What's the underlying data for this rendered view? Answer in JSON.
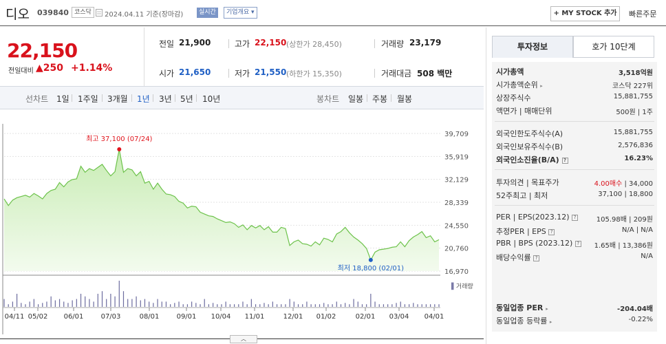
{
  "header": {
    "name": "디오",
    "code": "039840",
    "market": "코스닥",
    "date": "2024.04.11 기준(장마감)",
    "realtime": "실시간",
    "company": "기업개요 ▾",
    "mystock": "+ MY STOCK 추가",
    "quick_order": "빠른주문"
  },
  "summary": {
    "price": "22,150",
    "change_label": "전일대비",
    "change_value": "▲250",
    "change_pct": "+1.14%",
    "prev_label": "전일",
    "prev": "21,900",
    "high_label": "고가",
    "high": "22,150",
    "upper_limit": "(상한가 28,450)",
    "volume_label": "거래량",
    "volume": "23,179",
    "open_label": "시가",
    "open": "21,650",
    "low_label": "저가",
    "low": "21,550",
    "lower_limit": "(하한가 15,350)",
    "amount_label": "거래대금",
    "amount": "508 백만"
  },
  "periods": {
    "line_label": "선차트",
    "items": [
      "1일",
      "1주일",
      "3개월",
      "1년",
      "3년",
      "5년",
      "10년"
    ],
    "active": "1년",
    "candle_label": "봉차트",
    "candle_items": [
      "일봉",
      "주봉",
      "월봉"
    ]
  },
  "chart_data": {
    "type": "area",
    "y_ticks": [
      "39,709",
      "35,919",
      "32,129",
      "28,339",
      "24,550",
      "20,760",
      "16,970"
    ],
    "ylim": [
      16970,
      39709
    ],
    "x_ticks": [
      "04/11",
      "05/02",
      "06/01",
      "07/03",
      "08/01",
      "09/01",
      "10/04",
      "11/01",
      "12/01",
      "01/02",
      "02/01",
      "03/04",
      "04/01"
    ],
    "series": [
      {
        "values": [
          28900,
          27800,
          28700,
          29100,
          29300,
          29500,
          29200,
          29800,
          29400,
          28900,
          29800,
          30300,
          30500,
          31600,
          30900,
          31700,
          32100,
          32200,
          34300,
          33300,
          33900,
          33600,
          34100,
          34600,
          33600,
          32700,
          33400,
          37100,
          33300,
          33900,
          33700,
          32700,
          33400,
          31500,
          31800,
          30500,
          31500,
          30500,
          29700,
          29600,
          29300,
          28500,
          28200,
          27400,
          27700,
          27600,
          26700,
          26400,
          26100,
          26000,
          25600,
          25300,
          25000,
          25100,
          24800,
          24200,
          24600,
          23800,
          24500,
          24100,
          24500,
          23800,
          24300,
          23400,
          23400,
          24200,
          24000,
          21200,
          21800,
          22100,
          21500,
          21400,
          21100,
          21800,
          21300,
          22400,
          22200,
          21800,
          23100,
          23500,
          24200,
          23300,
          22600,
          22100,
          21500,
          20700,
          18800,
          20100,
          20500,
          20600,
          20700,
          20900,
          21000,
          21800,
          21000,
          22000,
          22600,
          23000,
          23500,
          22500,
          22800,
          21800,
          22150
        ]
      }
    ],
    "volume": [
      0.3,
      0.1,
      0.2,
      0.5,
      0.15,
      0.1,
      0.2,
      0.3,
      0.1,
      0.15,
      0.2,
      0.4,
      0.25,
      0.3,
      0.2,
      0.15,
      0.25,
      0.3,
      0.5,
      0.4,
      0.3,
      0.2,
      0.5,
      0.6,
      0.3,
      0.5,
      0.4,
      1.0,
      0.6,
      0.3,
      0.3,
      0.4,
      0.25,
      0.3,
      0.2,
      0.15,
      0.3,
      0.2,
      0.2,
      0.1,
      0.15,
      0.2,
      0.1,
      0.1,
      0.2,
      0.15,
      0.1,
      0.3,
      0.1,
      0.15,
      0.1,
      0.1,
      0.2,
      0.1,
      0.1,
      0.1,
      0.2,
      0.1,
      0.3,
      0.1,
      0.1,
      0.15,
      0.1,
      0.2,
      0.1,
      0.1,
      0.1,
      0.3,
      0.2,
      0.1,
      0.1,
      0.2,
      0.1,
      0.1,
      0.1,
      0.15,
      0.1,
      0.1,
      0.2,
      0.1,
      0.15,
      0.1,
      0.3,
      0.2,
      0.1,
      0.1,
      0.5,
      0.2,
      0.1,
      0.1,
      0.1,
      0.1,
      0.15,
      0.2,
      0.1,
      0.1,
      0.15,
      0.1,
      0.1,
      0.1,
      0.1,
      0.1,
      0.1
    ],
    "high_label": "최고 37,100 (07/24)",
    "low_label": "최저 18,800 (02/01)",
    "volume_label": "거래량",
    "colors": {
      "line": "#6cc24a",
      "fill_top": "#c8ecb4",
      "fill_bottom": "#f3fbee",
      "high_dot": "#e0141c",
      "low_dot": "#1f5fc4"
    }
  },
  "scroll_button": "︿",
  "tabs": {
    "invest": "투자정보",
    "ask": "호가 10단계"
  },
  "info": {
    "market_cap_label": "시가총액",
    "market_cap": "3,518억원",
    "cap_rank_label": "시가총액순위",
    "cap_rank": "코스닥 227위",
    "shares_label": "상장주식수",
    "shares": "15,881,755",
    "par_label": "액면가 | 매매단위",
    "par": "500원 | 1주",
    "foreign_limit_label": "외국인한도주식수(A)",
    "foreign_limit": "15,881,755",
    "foreign_hold_label": "외국인보유주식수(B)",
    "foreign_hold": "2,576,836",
    "foreign_rate_label": "외국인소진율(B/A)",
    "foreign_rate": "16.23%",
    "opinion_label": "투자의견 | 목표주가",
    "opinion": "4.00매수",
    "target": " | 34,000",
    "week52_label": "52주최고 | 최저",
    "week52": "37,100 | 18,800",
    "per_label": "PER | EPS(2023.12)",
    "per": "105.98배 | 209원",
    "est_per_label": "추정PER | EPS",
    "est_per": "N/A | N/A",
    "pbr_label": "PBR | BPS (2023.12)",
    "pbr": "1.65배 | 13,386원",
    "div_label": "배당수익률",
    "div": "N/A",
    "sector_per_label": "동일업종 PER",
    "sector_per": "-204.04배",
    "sector_rate_label": "동일업종 등락률",
    "sector_rate": "-0.22%"
  }
}
